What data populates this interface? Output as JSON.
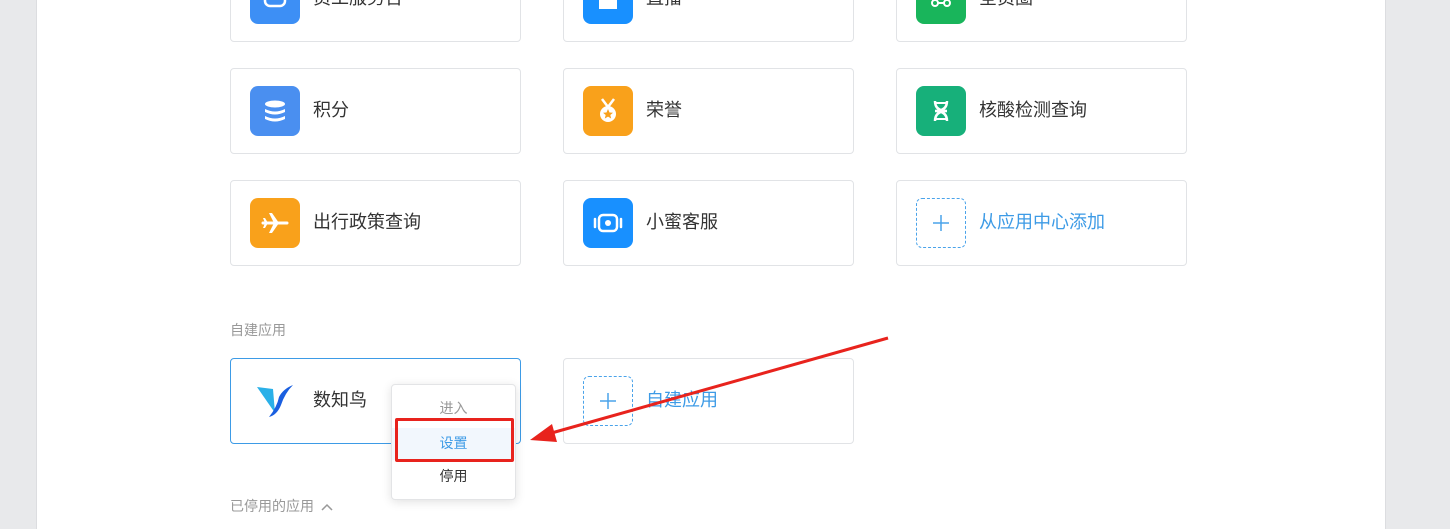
{
  "apps_row1": [
    {
      "label": "员工服务台",
      "icon": "service-desk-icon",
      "color": "#3d8ff5"
    },
    {
      "label": "直播",
      "icon": "live-icon",
      "color": "#1890ff"
    },
    {
      "label": "全员圈",
      "icon": "circle-icon",
      "color": "#19b55b"
    }
  ],
  "apps_row2": [
    {
      "label": "积分",
      "icon": "points-icon",
      "color": "#4a8ff0"
    },
    {
      "label": "荣誉",
      "icon": "medal-icon",
      "color": "#f9a11b"
    },
    {
      "label": "核酸检测查询",
      "icon": "dna-icon",
      "color": "#17b07a"
    }
  ],
  "apps_row3": [
    {
      "label": "出行政策查询",
      "icon": "airplane-icon",
      "color": "#f9a11b"
    },
    {
      "label": "小蜜客服",
      "icon": "robot-icon",
      "color": "#1890ff"
    }
  ],
  "add_from_center": "从应用中心添加",
  "custom_section_title": "自建应用",
  "custom_app": {
    "label": "数知鸟",
    "icon": "bird-logo-icon"
  },
  "add_custom": "自建应用",
  "context_menu": {
    "enter": "进入",
    "settings": "设置",
    "disable": "停用"
  },
  "disabled_section_title": "已停用的应用",
  "colors": {
    "accent": "#3d9be6",
    "annotation": "#e8231d"
  }
}
